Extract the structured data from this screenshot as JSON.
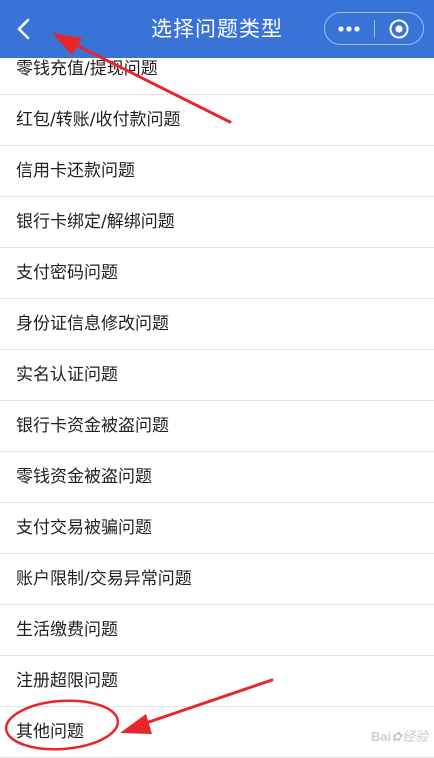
{
  "header": {
    "title": "选择问题类型",
    "back_icon": "chevron-left-icon",
    "more_icon": "more-dots-icon",
    "close_icon": "target-close-icon",
    "bar_color": "#3a73d8"
  },
  "list": {
    "items": [
      "零钱充值/提现问题",
      "红包/转账/收付款问题",
      "信用卡还款问题",
      "银行卡绑定/解绑问题",
      "支付密码问题",
      "身份证信息修改问题",
      "实名认证问题",
      "银行卡资金被盗问题",
      "零钱资金被盗问题",
      "支付交易被骗问题",
      "账户限制/交易异常问题",
      "生活缴费问题",
      "注册超限问题",
      "其他问题"
    ]
  },
  "annotations": {
    "color": "#e8262a"
  },
  "watermark": {
    "brand": "Bai",
    "suffix": "经验"
  }
}
